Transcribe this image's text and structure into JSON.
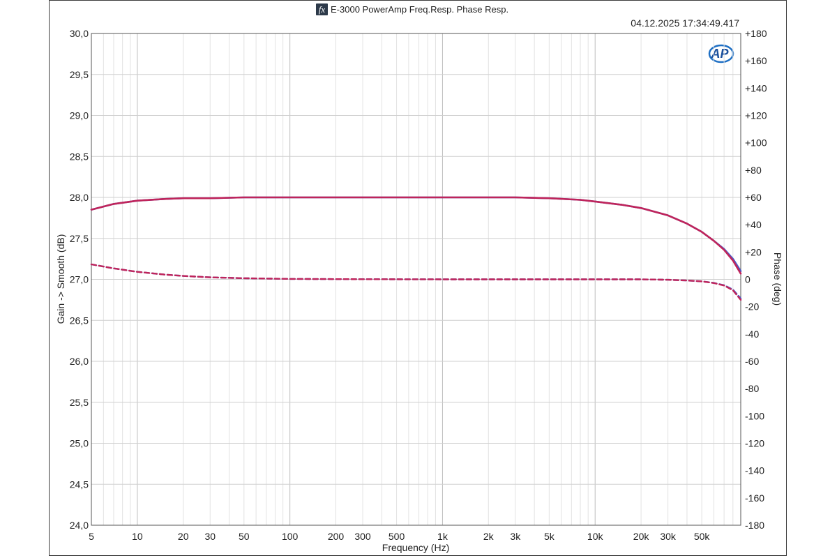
{
  "header": {
    "fx_icon_label": "fx",
    "title": "E-3000 PowerAmp Freq.Resp. Phase Resp.",
    "timestamp": "04.12.2025 17:34:49.417",
    "logo_text": "AP"
  },
  "chart_data": {
    "type": "line",
    "xlabel": "Frequency (Hz)",
    "ylabel": "Gain -> Smooth (dB)",
    "y2label": "Phase (deg)",
    "xscale": "log",
    "xlim": [
      5,
      90000
    ],
    "ylim": [
      24.0,
      30.0
    ],
    "y2lim": [
      -180,
      180
    ],
    "grid": true,
    "x_ticks": [
      {
        "value": 5,
        "label": "5"
      },
      {
        "value": 10,
        "label": "10"
      },
      {
        "value": 20,
        "label": "20"
      },
      {
        "value": 30,
        "label": "30"
      },
      {
        "value": 50,
        "label": "50"
      },
      {
        "value": 100,
        "label": "100"
      },
      {
        "value": 200,
        "label": "200"
      },
      {
        "value": 300,
        "label": "300"
      },
      {
        "value": 500,
        "label": "500"
      },
      {
        "value": 1000,
        "label": "1k"
      },
      {
        "value": 2000,
        "label": "2k"
      },
      {
        "value": 3000,
        "label": "3k"
      },
      {
        "value": 5000,
        "label": "5k"
      },
      {
        "value": 10000,
        "label": "10k"
      },
      {
        "value": 20000,
        "label": "20k"
      },
      {
        "value": 30000,
        "label": "30k"
      },
      {
        "value": 50000,
        "label": "50k"
      }
    ],
    "y_ticks": [
      {
        "value": 30.0,
        "label": "30,0"
      },
      {
        "value": 29.5,
        "label": "29,5"
      },
      {
        "value": 29.0,
        "label": "29,0"
      },
      {
        "value": 28.5,
        "label": "28,5"
      },
      {
        "value": 28.0,
        "label": "28,0"
      },
      {
        "value": 27.5,
        "label": "27,5"
      },
      {
        "value": 27.0,
        "label": "27,0"
      },
      {
        "value": 26.5,
        "label": "26,5"
      },
      {
        "value": 26.0,
        "label": "26,0"
      },
      {
        "value": 25.5,
        "label": "25,5"
      },
      {
        "value": 25.0,
        "label": "25,0"
      },
      {
        "value": 24.5,
        "label": "24,5"
      },
      {
        "value": 24.0,
        "label": "24,0"
      }
    ],
    "y2_ticks": [
      {
        "value": 180,
        "label": "+180"
      },
      {
        "value": 160,
        "label": "+160"
      },
      {
        "value": 140,
        "label": "+140"
      },
      {
        "value": 120,
        "label": "+120"
      },
      {
        "value": 100,
        "label": "+100"
      },
      {
        "value": 80,
        "label": "+80"
      },
      {
        "value": 60,
        "label": "+60"
      },
      {
        "value": 40,
        "label": "+40"
      },
      {
        "value": 20,
        "label": "+20"
      },
      {
        "value": 0,
        "label": "0"
      },
      {
        "value": -20,
        "label": "-20"
      },
      {
        "value": -40,
        "label": "-40"
      },
      {
        "value": -60,
        "label": "-60"
      },
      {
        "value": -80,
        "label": "-80"
      },
      {
        "value": -100,
        "label": "-100"
      },
      {
        "value": -120,
        "label": "-120"
      },
      {
        "value": -140,
        "label": "-140"
      },
      {
        "value": -160,
        "label": "-160"
      },
      {
        "value": -180,
        "label": "-180"
      }
    ],
    "series": [
      {
        "axis": "left",
        "style": "solid",
        "color": "#c0245a",
        "x": [
          5,
          7,
          10,
          15,
          20,
          30,
          50,
          100,
          1000,
          3000,
          5000,
          8000,
          10000,
          15000,
          20000,
          30000,
          40000,
          50000,
          60000,
          70000,
          80000,
          90000
        ],
        "y": [
          27.85,
          27.92,
          27.96,
          27.98,
          27.99,
          27.99,
          28.0,
          28.0,
          28.0,
          28.0,
          27.99,
          27.97,
          27.95,
          27.91,
          27.87,
          27.78,
          27.68,
          27.58,
          27.47,
          27.36,
          27.23,
          27.07
        ]
      },
      {
        "axis": "left",
        "style": "solid",
        "color": "#4a5cc8",
        "x": [
          5,
          7,
          10,
          15,
          20,
          30,
          50,
          100,
          1000,
          3000,
          5000,
          8000,
          10000,
          15000,
          20000,
          30000,
          40000,
          50000,
          60000,
          70000,
          80000,
          90000
        ],
        "y": [
          27.85,
          27.92,
          27.96,
          27.98,
          27.99,
          27.99,
          28.0,
          28.0,
          28.0,
          28.0,
          27.99,
          27.97,
          27.95,
          27.91,
          27.87,
          27.78,
          27.68,
          27.58,
          27.47,
          27.37,
          27.25,
          27.1
        ]
      },
      {
        "axis": "right",
        "style": "dashed",
        "color": "#c0245a",
        "x": [
          5,
          7,
          10,
          15,
          20,
          30,
          50,
          100,
          300,
          1000,
          3000,
          10000,
          20000,
          30000,
          40000,
          50000,
          60000,
          70000,
          80000,
          90000
        ],
        "y": [
          11,
          8,
          5.5,
          3.5,
          2.5,
          1.5,
          0.8,
          0.3,
          0.1,
          0,
          0,
          0,
          0,
          -0.3,
          -0.8,
          -1.5,
          -2.7,
          -4.5,
          -8,
          -15
        ]
      },
      {
        "axis": "right",
        "style": "dashed",
        "color": "#4a5cc8",
        "x": [
          5,
          7,
          10,
          15,
          20,
          30,
          50,
          100,
          300,
          1000,
          3000,
          10000,
          20000,
          30000,
          40000,
          50000,
          60000,
          70000,
          80000,
          90000
        ],
        "y": [
          11,
          8,
          5.5,
          3.5,
          2.5,
          1.5,
          0.8,
          0.3,
          0.1,
          0,
          0,
          0,
          0,
          -0.3,
          -0.8,
          -1.5,
          -2.6,
          -4.3,
          -7.5,
          -14
        ]
      }
    ]
  }
}
